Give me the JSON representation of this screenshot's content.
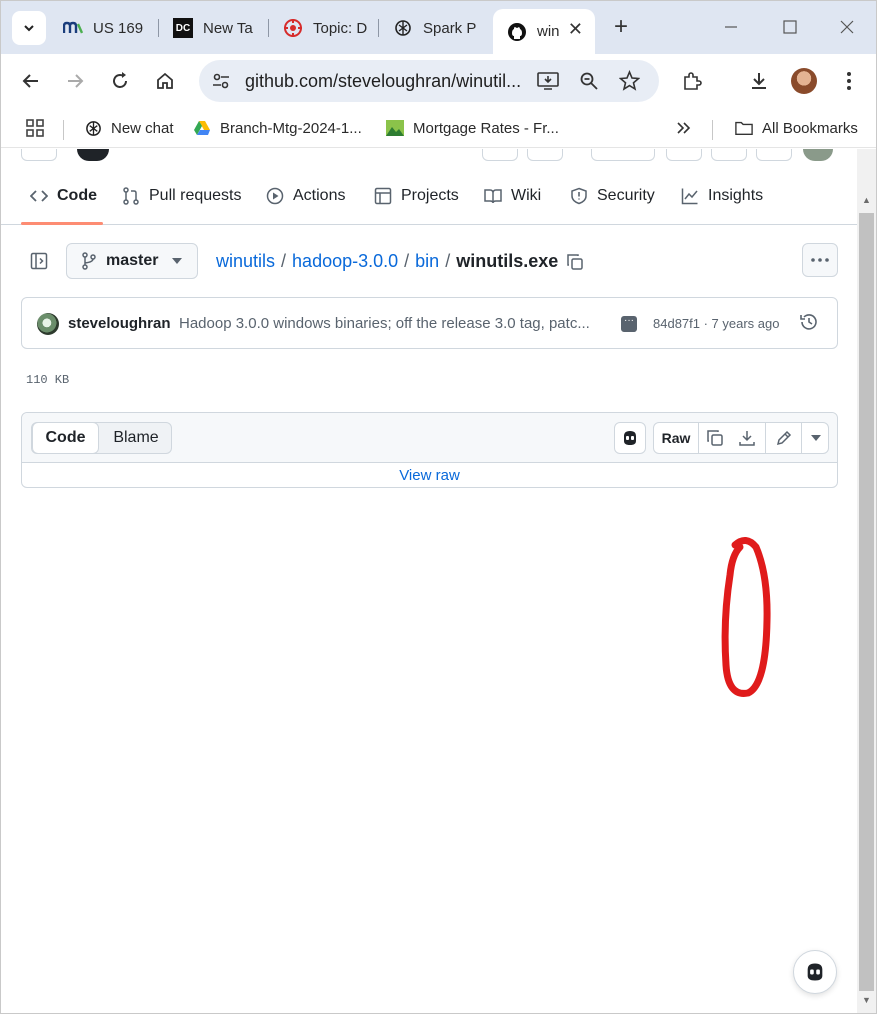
{
  "browser": {
    "tabs": [
      {
        "label": "US 169",
        "favicon": "mn-icon",
        "active": false
      },
      {
        "label": "New Ta",
        "favicon": "dc-icon",
        "active": false
      },
      {
        "label": "Topic: D",
        "favicon": "target-icon",
        "active": false
      },
      {
        "label": "Spark P",
        "favicon": "openai-icon",
        "active": false
      },
      {
        "label": "win",
        "favicon": "github-icon",
        "active": true
      }
    ],
    "url": "github.com/steveloughran/winutil...",
    "bookmarks": [
      {
        "label": "New chat",
        "favicon": "openai-icon"
      },
      {
        "label": "Branch-Mtg-2024-1...",
        "favicon": "drive-icon"
      },
      {
        "label": "Mortgage Rates - Fr...",
        "favicon": "image-icon"
      },
      {
        "label": "All Bookmarks",
        "favicon": "folder-icon"
      }
    ]
  },
  "repo_nav": {
    "items": [
      {
        "label": "Code",
        "icon": "code-icon",
        "selected": true
      },
      {
        "label": "Pull requests",
        "icon": "pull-request-icon"
      },
      {
        "label": "Actions",
        "icon": "play-icon"
      },
      {
        "label": "Projects",
        "icon": "table-icon"
      },
      {
        "label": "Wiki",
        "icon": "book-icon"
      },
      {
        "label": "Security",
        "icon": "shield-icon"
      },
      {
        "label": "Insights",
        "icon": "graph-icon"
      }
    ],
    "accent": "#fd8c73"
  },
  "file_nav": {
    "branch": "master",
    "breadcrumb": [
      "winutils",
      "hadoop-3.0.0",
      "bin"
    ],
    "separator": "/",
    "current_file": "winutils.exe"
  },
  "commit": {
    "author": "steveloughran",
    "message": "Hadoop 3.0.0 windows binaries; off the release 3.0 tag, patc...",
    "hash_time": "84d87f1 · 7 years ago"
  },
  "file": {
    "size": "110 KB",
    "view_tabs": [
      "Code",
      "Blame"
    ],
    "raw_label": "Raw",
    "view_raw_link": "View raw"
  },
  "colors": {
    "link": "#0969da",
    "annotation": "#e01b1b"
  }
}
